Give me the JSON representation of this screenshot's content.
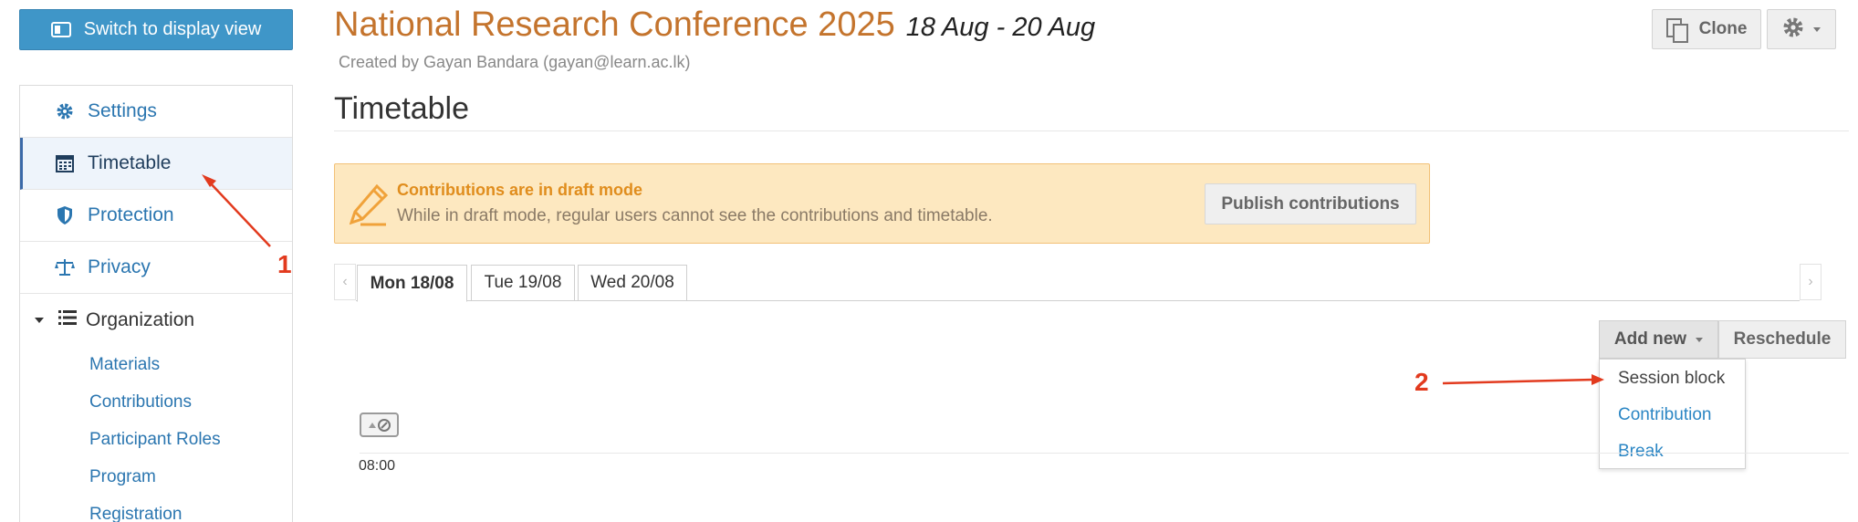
{
  "switch_button": {
    "label": "Switch to display view",
    "icon": "display-view-icon"
  },
  "sidebar": {
    "items": [
      {
        "label": "Settings",
        "icon": "gear-icon"
      },
      {
        "label": "Timetable",
        "icon": "calendar-icon",
        "active": true
      },
      {
        "label": "Protection",
        "icon": "shield-icon"
      },
      {
        "label": "Privacy",
        "icon": "scale-icon"
      }
    ],
    "organization": {
      "label": "Organization",
      "icon": "list-icon",
      "expanded": true,
      "children": [
        "Materials",
        "Contributions",
        "Participant Roles",
        "Program",
        "Registration"
      ]
    }
  },
  "header": {
    "title": "National Research Conference 2025",
    "dates": "18 Aug - 20 Aug",
    "created_by": "Created by Gayan Bandara (gayan@learn.ac.lk)",
    "clone_label": "Clone"
  },
  "page": {
    "title": "Timetable"
  },
  "draft_banner": {
    "heading": "Contributions are in draft mode",
    "text": "While in draft mode, regular users cannot see the contributions and timetable.",
    "publish_label": "Publish contributions"
  },
  "day_tabs": [
    {
      "label": "Mon 18/08",
      "active": true
    },
    {
      "label": "Tue 19/08"
    },
    {
      "label": "Wed 20/08"
    }
  ],
  "toolbar": {
    "add_new_label": "Add new",
    "reschedule_label": "Reschedule",
    "add_new_menu": [
      "Session block",
      "Contribution",
      "Break"
    ]
  },
  "timeline": {
    "first_time": "08:00"
  },
  "annotations": {
    "marker_1": "1",
    "marker_2": "2"
  },
  "colors": {
    "accent_blue": "#3f96c8",
    "title_orange": "#c4742d",
    "warning_bg": "#fde8c0",
    "warning_text": "#e08d1d",
    "annotation_red": "#e23a1e"
  }
}
